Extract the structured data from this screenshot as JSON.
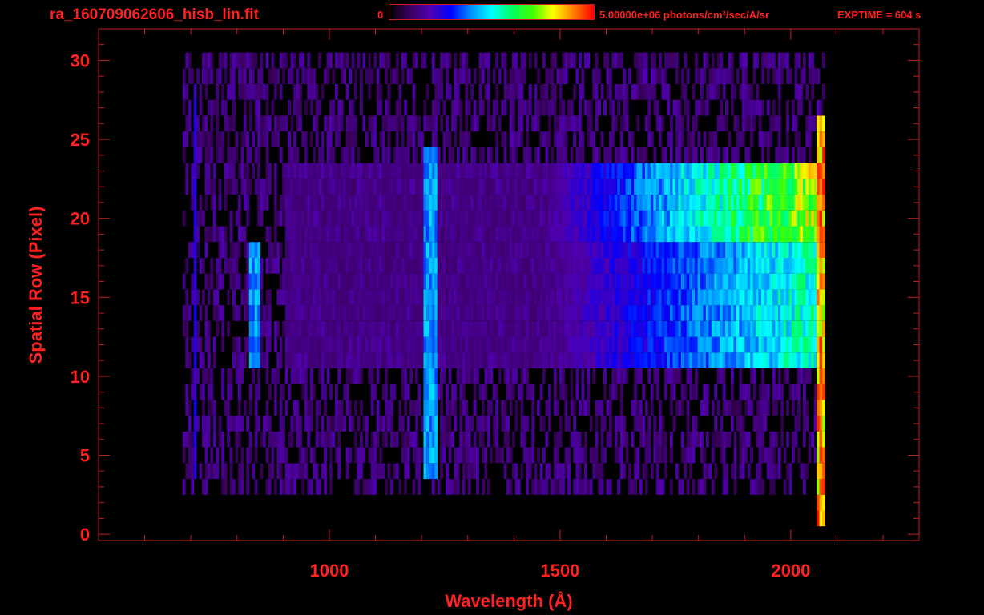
{
  "header": {
    "title": "ra_160709062606_hisb_lin.fit",
    "colorbar_min_label": "0",
    "colorbar_max_label": "5.00000e+06 photons/cm²/sec/A/sr",
    "exptime_label": "EXPTIME = 604 s"
  },
  "colors": {
    "text": "#ff2020",
    "axis": "#c02020",
    "background": "#000000"
  },
  "chart_data": {
    "type": "heatmap",
    "xlabel": "Wavelength (Å)",
    "ylabel": "Spatial Row (Pixel)",
    "xlim": [
      500,
      2278
    ],
    "ylim": [
      -0.4,
      32
    ],
    "x_ticks": [
      {
        "value": 1000,
        "label": "1000"
      },
      {
        "value": 1500,
        "label": "1500"
      },
      {
        "value": 2000,
        "label": "2000"
      }
    ],
    "y_ticks": [
      {
        "value": 0,
        "label": "0"
      },
      {
        "value": 5,
        "label": "5"
      },
      {
        "value": 10,
        "label": "10"
      },
      {
        "value": 15,
        "label": "15"
      },
      {
        "value": 20,
        "label": "20"
      },
      {
        "value": 25,
        "label": "25"
      },
      {
        "value": 30,
        "label": "30"
      }
    ],
    "color_range": [
      0,
      5000000
    ],
    "colormap": "rainbow",
    "data_extent": {
      "wavelength": [
        680,
        2070
      ],
      "rows": [
        3,
        30
      ]
    },
    "features": [
      {
        "name": "extended source band",
        "rows": [
          11,
          23
        ],
        "wavelength": [
          1450,
          2060
        ],
        "relative_peak": 0.75
      },
      {
        "name": "Lyman-alpha line",
        "wavelength": 1216,
        "rows": [
          4,
          24
        ],
        "relative_peak": 0.45
      },
      {
        "name": "emission line",
        "wavelength": 835,
        "rows": [
          11,
          18
        ],
        "relative_peak": 0.45
      },
      {
        "name": "emission line",
        "wavelength": 705,
        "rows": [
          4,
          28
        ],
        "relative_peak": 0.3
      },
      {
        "name": "detector edge",
        "wavelength": 2062,
        "rows": [
          1,
          26
        ],
        "relative_peak": 0.95
      }
    ]
  }
}
